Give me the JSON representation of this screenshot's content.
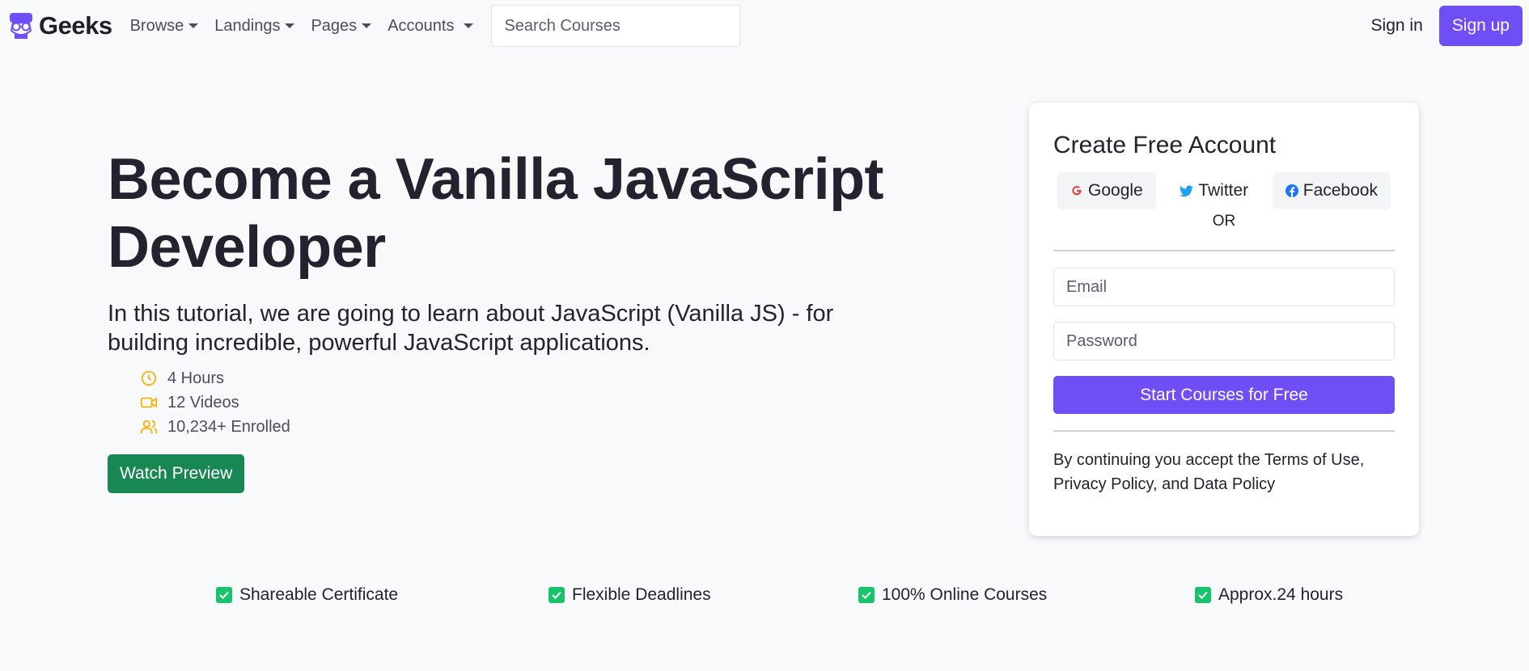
{
  "nav": {
    "brand": "Geeks",
    "items": [
      {
        "label": "Browse"
      },
      {
        "label": "Landings"
      },
      {
        "label": "Pages"
      },
      {
        "label": "Accounts"
      }
    ],
    "search_placeholder": "Search Courses",
    "signin": "Sign in",
    "signup": "Sign up"
  },
  "hero": {
    "title": "Become a Vanilla JavaScript Developer",
    "description": "In this tutorial, we are going to learn about JavaScript (Vanilla JS) - for building incredible, powerful JavaScript applications.",
    "meta": [
      {
        "icon": "clock-icon",
        "text": "4 Hours"
      },
      {
        "icon": "video-icon",
        "text": "12 Videos"
      },
      {
        "icon": "users-icon",
        "text": "10,234+ Enrolled"
      }
    ],
    "watch_button": "Watch Preview"
  },
  "signup_card": {
    "title": "Create Free Account",
    "social": [
      {
        "label": "Google",
        "icon": "google-icon"
      },
      {
        "label": "Twitter",
        "icon": "twitter-icon"
      },
      {
        "label": "Facebook",
        "icon": "facebook-icon"
      }
    ],
    "or": "OR",
    "email_placeholder": "Email",
    "password_placeholder": "Password",
    "start_button": "Start Courses for Free",
    "terms": "By continuing you accept the Terms of Use, Privacy Policy, and Data Policy"
  },
  "features": [
    {
      "label": "Shareable Certificate"
    },
    {
      "label": "Flexible Deadlines"
    },
    {
      "label": "100% Online Courses"
    },
    {
      "label": "Approx.24 hours"
    }
  ],
  "colors": {
    "primary": "#6f4ef6",
    "success": "#198754",
    "meta_icon": "#f5b60b",
    "check": "#19c36b",
    "google": "#e53935",
    "twitter": "#1da1f2",
    "facebook": "#1877f2"
  }
}
